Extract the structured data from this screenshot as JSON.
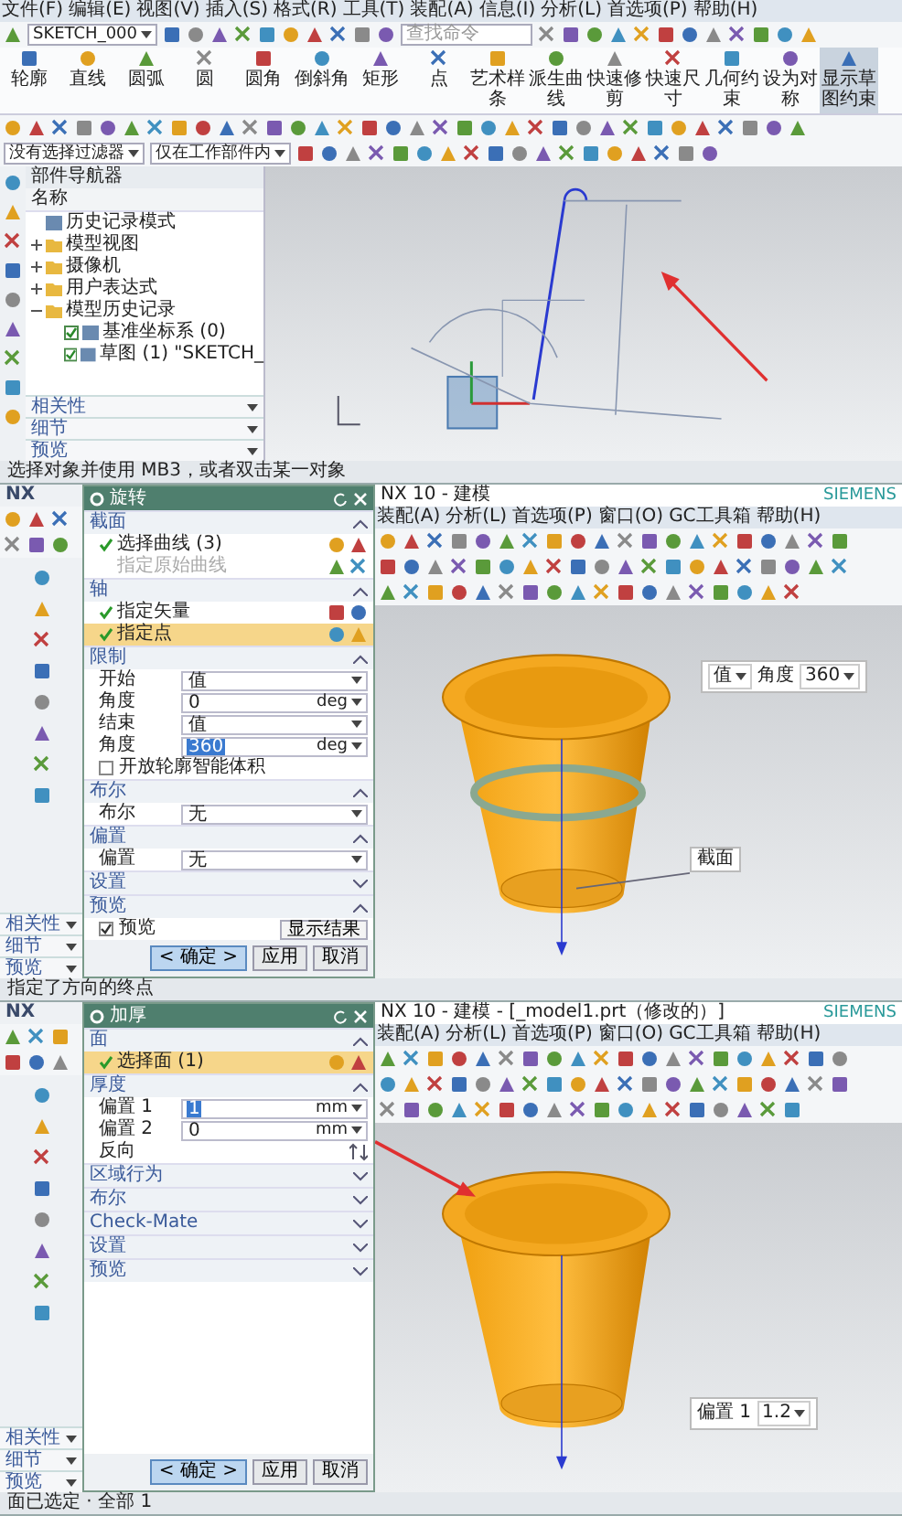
{
  "panels": [
    {
      "kind": "sketch",
      "menu": [
        "文件(F)",
        "编辑(E)",
        "视图(V)",
        "插入(S)",
        "格式(R)",
        "工具(T)",
        "装配(A)",
        "信息(I)",
        "分析(L)",
        "首选项(P)",
        "帮助(H)"
      ],
      "sketch_name": "SKETCH_000",
      "search_placeholder": "查找命令",
      "ribbon": [
        {
          "label": "轮廓",
          "selected": false
        },
        {
          "label": "直线",
          "selected": false
        },
        {
          "label": "圆弧",
          "selected": false
        },
        {
          "label": "圆",
          "selected": false
        },
        {
          "label": "圆角",
          "selected": false
        },
        {
          "label": "倒斜角",
          "selected": false
        },
        {
          "label": "矩形",
          "selected": false
        },
        {
          "label": "点",
          "selected": false
        },
        {
          "label": "艺术样条",
          "selected": false
        },
        {
          "label": "派生曲线",
          "selected": false
        },
        {
          "label": "快速修剪",
          "selected": false
        },
        {
          "label": "快速尺寸",
          "selected": false
        },
        {
          "label": "几何约束",
          "selected": false
        },
        {
          "label": "设为对称",
          "selected": false
        },
        {
          "label": "显示草图约束",
          "selected": true
        }
      ],
      "filters": [
        "没有选择过滤器",
        "仅在工作部件内"
      ],
      "navigator": {
        "title": "部件导航器",
        "column": "名称",
        "items": [
          {
            "label": "历史记录模式",
            "kind": "leaf"
          },
          {
            "label": "模型视图",
            "kind": "node",
            "expanded": false
          },
          {
            "label": "摄像机",
            "kind": "node",
            "expanded": false
          },
          {
            "label": "用户表达式",
            "kind": "node",
            "expanded": false
          },
          {
            "label": "模型历史记录",
            "kind": "node",
            "expanded": true,
            "children": [
              {
                "label": "基准坐标系 (0)",
                "kind": "check",
                "checked": true
              },
              {
                "label": "草图 (1) \"SKETCH_",
                "kind": "check",
                "checked": true
              }
            ]
          }
        ],
        "panes": [
          "相关性",
          "细节",
          "预览"
        ]
      },
      "status": "选择对象并使用 MB3，或者双击某一对象"
    },
    {
      "kind": "revolve",
      "logo": "NX",
      "title": "NX 10 - 建模",
      "brand": "SIEMENS",
      "menu": [
        "装配(A)",
        "分析(L)",
        "首选项(P)",
        "窗口(O)",
        "GC工具箱",
        "帮助(H)"
      ],
      "panes": [
        "相关性",
        "细节",
        "预览"
      ],
      "dialog": {
        "title": "旋转",
        "rows": [
          {
            "kind": "section",
            "label": "截面",
            "expanded": true
          },
          {
            "kind": "select",
            "label": "选择曲线 (3)",
            "done": true,
            "selected": false,
            "disabled": false
          },
          {
            "kind": "select",
            "label": "指定原始曲线",
            "done": false,
            "selected": false,
            "disabled": true
          },
          {
            "kind": "section",
            "label": "轴",
            "expanded": true
          },
          {
            "kind": "select",
            "label": "指定矢量",
            "done": true,
            "selected": false,
            "disabled": false
          },
          {
            "kind": "select",
            "label": "指定点",
            "done": true,
            "selected": true,
            "disabled": false
          },
          {
            "kind": "section",
            "label": "限制",
            "expanded": true
          },
          {
            "kind": "field",
            "label": "开始",
            "value": "值",
            "unit": "",
            "dropdown": true,
            "selected": false
          },
          {
            "kind": "field",
            "label": "角度",
            "value": "0",
            "unit": "deg",
            "dropdown": true,
            "selected": false
          },
          {
            "kind": "field",
            "label": "结束",
            "value": "值",
            "unit": "",
            "dropdown": true,
            "selected": false
          },
          {
            "kind": "field",
            "label": "角度",
            "value": "360",
            "unit": "deg",
            "dropdown": true,
            "selected": true
          },
          {
            "kind": "checkbox",
            "label": "开放轮廓智能体积",
            "checked": false
          },
          {
            "kind": "section",
            "label": "布尔",
            "expanded": true
          },
          {
            "kind": "field",
            "label": "布尔",
            "value": "无",
            "unit": "",
            "dropdown": true,
            "selected": false
          },
          {
            "kind": "section",
            "label": "偏置",
            "expanded": true
          },
          {
            "kind": "field",
            "label": "偏置",
            "value": "无",
            "unit": "",
            "dropdown": true,
            "selected": false
          },
          {
            "kind": "section",
            "label": "设置",
            "expanded": false
          },
          {
            "kind": "section",
            "label": "预览",
            "expanded": true
          },
          {
            "kind": "preview",
            "label": "预览",
            "checked": true,
            "button": "显示结果"
          }
        ],
        "buttons": [
          {
            "label": "< 确定 >",
            "kind": "primary"
          },
          {
            "label": "应用",
            "kind": "normal"
          },
          {
            "label": "取消",
            "kind": "normal"
          }
        ]
      },
      "widget": {
        "value": "值",
        "label": "角度",
        "number": "360"
      },
      "callout": "截面",
      "status": "指定了方向的终点"
    },
    {
      "kind": "thicken",
      "logo": "NX",
      "title": "NX 10 - 建模 - [_model1.prt（修改的）]",
      "brand": "SIEMENS",
      "menu": [
        "装配(A)",
        "分析(L)",
        "首选项(P)",
        "窗口(O)",
        "GC工具箱",
        "帮助(H)"
      ],
      "panes": [
        "相关性",
        "细节",
        "预览"
      ],
      "dialog": {
        "title": "加厚",
        "rows": [
          {
            "kind": "section",
            "label": "面",
            "expanded": true
          },
          {
            "kind": "select",
            "label": "选择面 (1)",
            "done": true,
            "selected": true,
            "disabled": false
          },
          {
            "kind": "section",
            "label": "厚度",
            "expanded": true
          },
          {
            "kind": "field",
            "label": "偏置 1",
            "value": "1",
            "unit": "mm",
            "dropdown": true,
            "selected": true
          },
          {
            "kind": "field",
            "label": "偏置 2",
            "value": "0",
            "unit": "mm",
            "dropdown": true,
            "selected": false
          },
          {
            "kind": "action",
            "label": "反向"
          },
          {
            "kind": "section",
            "label": "区域行为",
            "expanded": false
          },
          {
            "kind": "section",
            "label": "布尔",
            "expanded": false
          },
          {
            "kind": "section",
            "label": "Check-Mate",
            "expanded": false
          },
          {
            "kind": "section",
            "label": "设置",
            "expanded": false
          },
          {
            "kind": "section",
            "label": "预览",
            "expanded": false
          }
        ],
        "buttons": [
          {
            "label": "< 确定 >",
            "kind": "primary"
          },
          {
            "label": "应用",
            "kind": "normal"
          },
          {
            "label": "取消",
            "kind": "normal"
          }
        ]
      },
      "widget": {
        "label": "偏置 1",
        "number": "1.2"
      },
      "status": "面已选定 · 全部 1"
    }
  ]
}
